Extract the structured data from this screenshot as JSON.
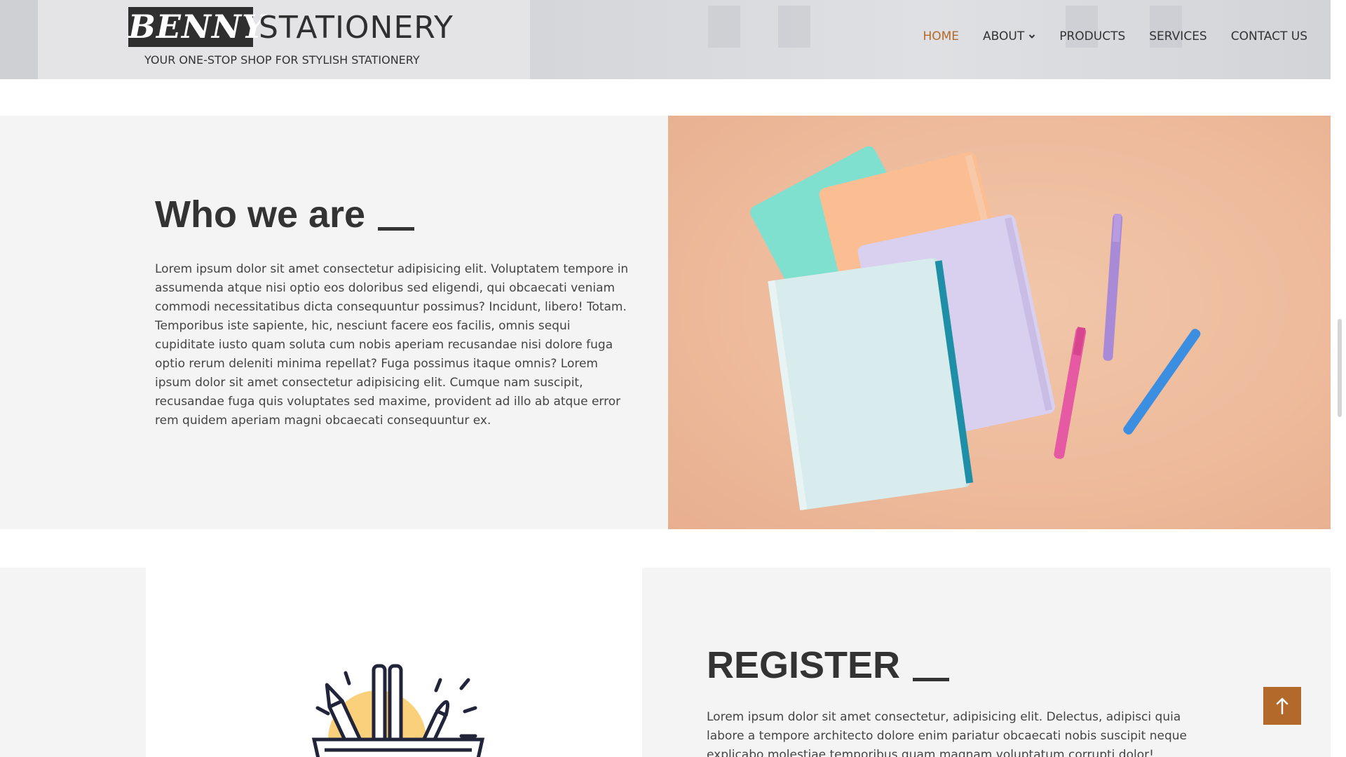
{
  "header": {
    "logo_mark": "BENNY",
    "logo_word": "STATIONERY",
    "tagline": "YOUR ONE-STOP SHOP FOR STYLISH STATIONERY",
    "nav": [
      {
        "label": "HOME",
        "active": true
      },
      {
        "label": "ABOUT",
        "has_dropdown": true
      },
      {
        "label": "PRODUCTS"
      },
      {
        "label": "SERVICES"
      },
      {
        "label": "CONTACT US"
      }
    ],
    "accent_color": "#b3692a"
  },
  "who": {
    "title": "Who we are",
    "body": "Lorem ipsum dolor sit amet consectetur adipisicing elit. Voluptatem tempore in assumenda atque nisi optio eos doloribus sed eligendi, qui obcaecati veniam commodi necessitatibus dicta consequuntur possimus? Incidunt, libero! Totam. Temporibus iste sapiente, hic, nesciunt facere eos facilis, omnis sequi cupiditate iusto quam soluta cum nobis aperiam recusandae nisi dolore fuga optio rerum deleniti minima repellat? Fuga possimus itaque omnis? Lorem ipsum dolor sit amet consectetur adipisicing elit. Cumque nam suscipit, recusandae fuga quis voluptates sed maxime, provident ad illo ab atque error rem quidem aperiam magni obcaecati consequuntur ex."
  },
  "register": {
    "title": "REGISTER",
    "body": "Lorem ipsum dolor sit amet consectetur, adipisicing elit. Delectus, adipisci quia labore a tempore architecto dolore enim pariatur obcaecati nobis suscipit neque explicabo molestiae temporibus quam magnam voluptatum corrupti dolor!"
  },
  "icons": {
    "chevron": "chevron-down-icon",
    "to_top": "arrow-up-icon",
    "stationery": "stationery-cup-icon"
  }
}
